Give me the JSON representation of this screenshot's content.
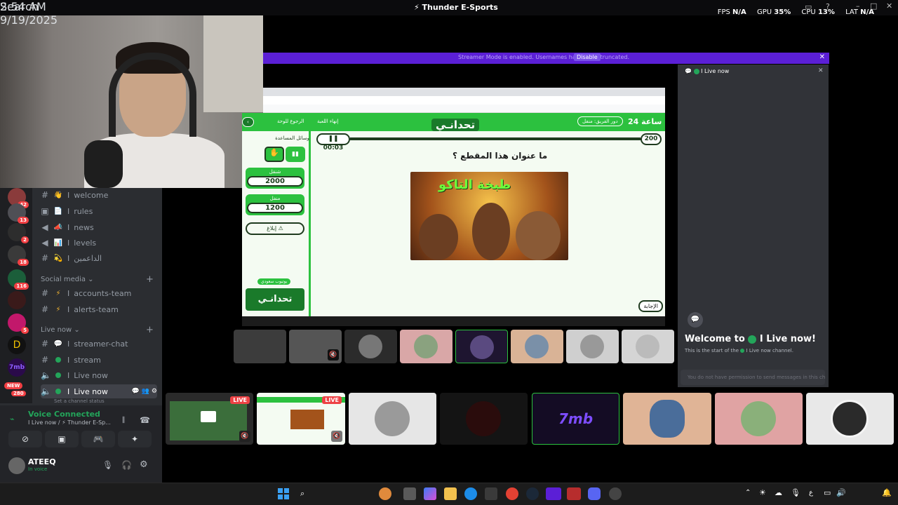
{
  "topbar": {
    "title": "⚡ Thunder E-Sports",
    "fps_label": "FPS",
    "fps": "N/A",
    "gpu_label": "GPU",
    "gpu": "35%",
    "cpu_label": "CPU",
    "cpu": "13%",
    "lat_label": "LAT",
    "lat": "N/A"
  },
  "servers": {
    "badges": [
      "42",
      "13",
      "2",
      "18",
      "116",
      "5",
      "280"
    ],
    "new_label": "NEW"
  },
  "channels": {
    "items": [
      {
        "name": "welcome",
        "emoji": "👋",
        "prefix": "I"
      },
      {
        "name": "rules",
        "emoji": "📄",
        "prefix": "I"
      },
      {
        "name": "news",
        "emoji": "📣",
        "prefix": "I"
      },
      {
        "name": "levels",
        "emoji": "📊",
        "prefix": "I"
      },
      {
        "name": "الداعمين",
        "emoji": "💫",
        "prefix": "I"
      }
    ],
    "cat_social": "Social media",
    "social": [
      {
        "name": "accounts-team",
        "prefix": "I"
      },
      {
        "name": "alerts-team",
        "prefix": "I"
      }
    ],
    "cat_live": "Live now",
    "live": [
      {
        "name": "streamer-chat",
        "prefix": "I"
      },
      {
        "name": "stream",
        "prefix": "I"
      },
      {
        "name": "Live now",
        "prefix": "I"
      },
      {
        "name": "Live now",
        "prefix": "I"
      }
    ],
    "status_hint": "Set a channel status"
  },
  "voice": {
    "connected": "Voice Connected",
    "location": "I Live now / ⚡ Thunder E-Sp..."
  },
  "user": {
    "name": "ATEEQ",
    "status": "In voice"
  },
  "share": {
    "banner": "Streamer Mode is enabled. Usernames have been truncated.",
    "banner_btn": "Disable"
  },
  "game": {
    "logo": "تحدانـي",
    "back": "الرجوع للوحة",
    "end": "إنهاء اللعبة",
    "team_turn": "دور الفريق: منفل",
    "hours": "24 ساعة",
    "tools": "وسائل المساعدة",
    "team1": "شنقل",
    "team1_score": "2000",
    "team2": "منفل",
    "team2_score": "1200",
    "report": "إبلاغ ⚠",
    "timer": "00:03",
    "points": "200",
    "question": "ما عنوان هذا المقطع ؟",
    "image_text": "طبخة التاكو",
    "answer": "الإجابة",
    "brand": "تحدانـي",
    "brand_tag": "يوتيوب سعودي"
  },
  "chat": {
    "header": "I Live now",
    "welcome": "Welcome to",
    "welcome_channel": "I Live now!",
    "start": "This is the start of the",
    "start_channel": "I Live now channel.",
    "noperm": "You do not have permission to send messages in this channel."
  },
  "tiles": {
    "live": "LIVE",
    "logo_text": "7mb"
  },
  "taskbar": {
    "search": "Search",
    "time": "2:54 AM",
    "date": "9/19/2025",
    "lang": "ع"
  },
  "colors": {
    "discord_bg": "#2b2d31",
    "green": "#23a55a",
    "game_green": "#2cc13f",
    "live_red": "#ed4245",
    "purple": "#5b1fd6"
  }
}
